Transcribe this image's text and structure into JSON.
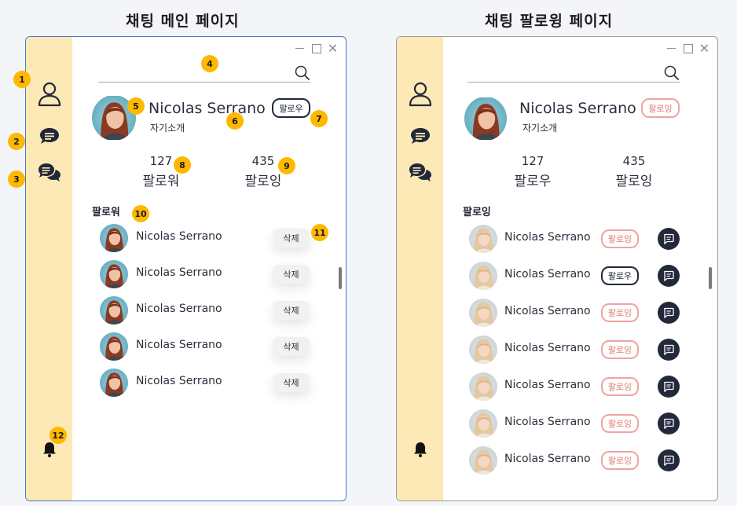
{
  "titles": {
    "left": "채팅 메인 페이지",
    "right": "채팅 팔로윙 페이지"
  },
  "profile": {
    "name": "Nicolas Serrano",
    "intro": "자기소개",
    "left_button": "팔로우",
    "right_button": "팔로잉",
    "followers_count": "127",
    "following_count": "435",
    "followers_label_left": "팔로워",
    "followers_label_right": "팔로우",
    "following_label": "팔로잉"
  },
  "left_list": {
    "title": "팔로워",
    "delete_label": "삭제",
    "items": [
      {
        "name": "Nicolas Serrano"
      },
      {
        "name": "Nicolas Serrano"
      },
      {
        "name": "Nicolas Serrano"
      },
      {
        "name": "Nicolas Serrano"
      },
      {
        "name": "Nicolas Serrano"
      }
    ]
  },
  "right_list": {
    "title": "팔로잉",
    "items": [
      {
        "name": "Nicolas Serrano",
        "button": "팔로잉"
      },
      {
        "name": "Nicolas Serrano",
        "button": "팔로우"
      },
      {
        "name": "Nicolas Serrano",
        "button": "팔로잉"
      },
      {
        "name": "Nicolas Serrano",
        "button": "팔로잉"
      },
      {
        "name": "Nicolas Serrano",
        "button": "팔로잉"
      },
      {
        "name": "Nicolas Serrano",
        "button": "팔로잉"
      },
      {
        "name": "Nicolas Serrano",
        "button": "팔로잉"
      }
    ]
  },
  "badges": [
    "1",
    "2",
    "3",
    "4",
    "5",
    "6",
    "7",
    "8",
    "9",
    "10",
    "11",
    "12"
  ],
  "colors": {
    "sidebar": "#fde9b5",
    "badge": "#ffb800",
    "follow_dark": "#22273a",
    "following_pink": "#f0a4a0",
    "left_border": "#4a78c9"
  },
  "icons": {
    "profile": "person-icon",
    "chat": "chat-bubble-icon",
    "group_chat": "group-chat-icon",
    "notify": "bell-icon",
    "search": "search-icon",
    "message": "message-icon"
  }
}
